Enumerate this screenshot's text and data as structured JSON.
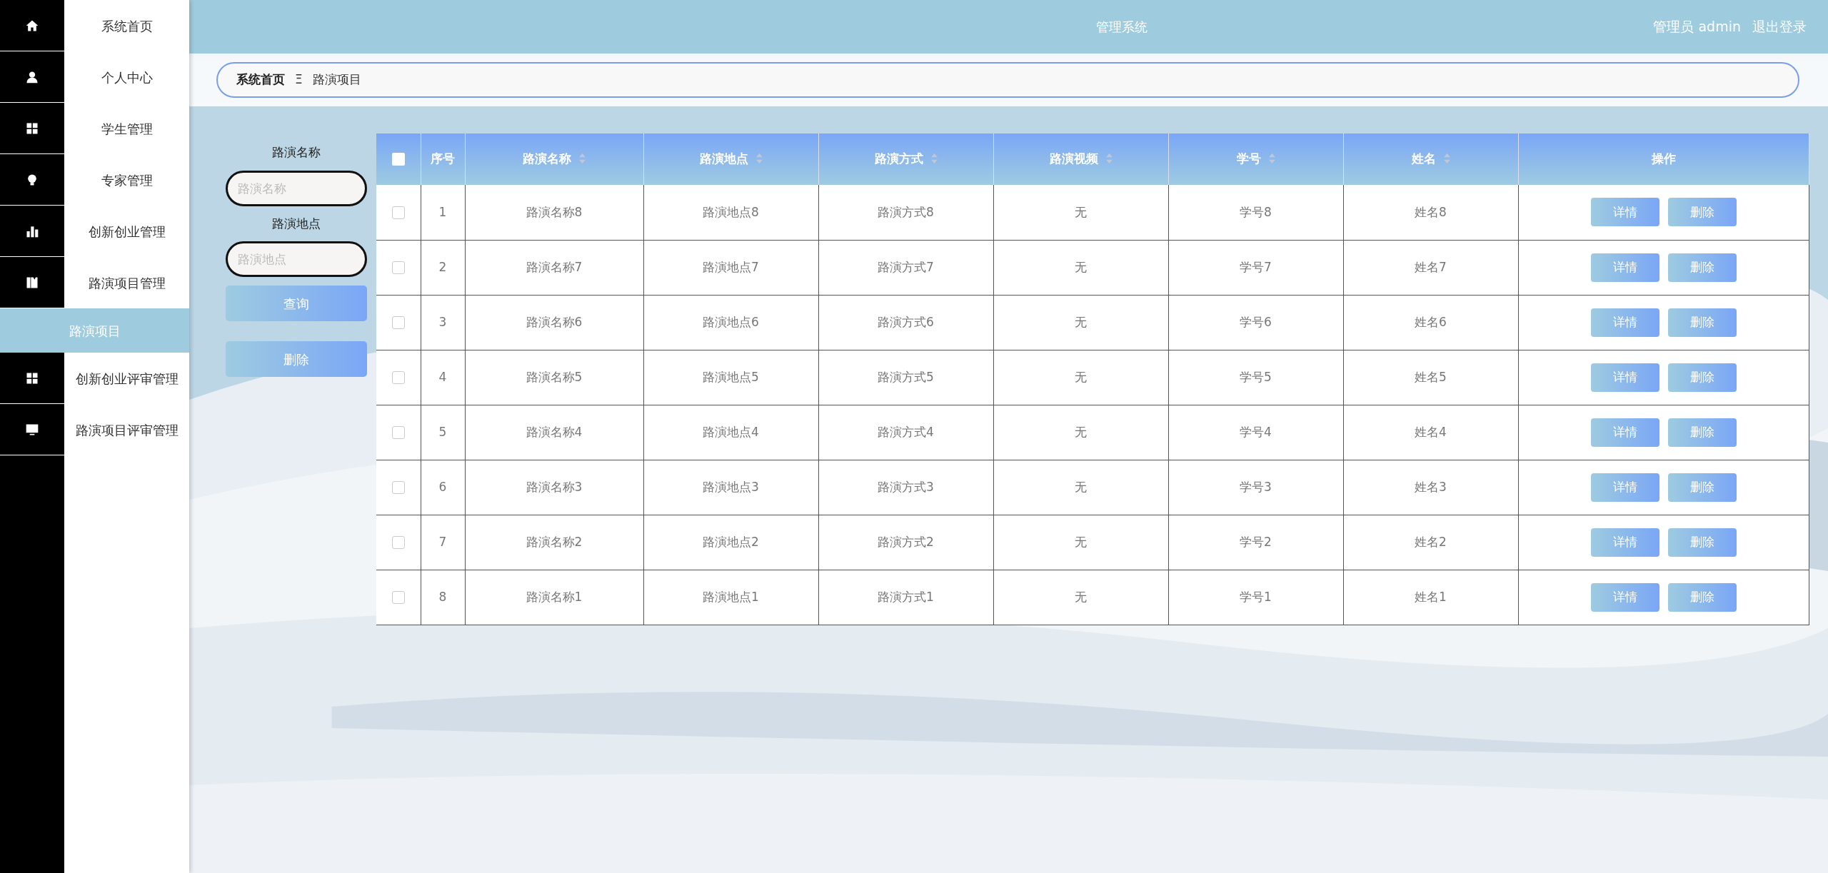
{
  "header": {
    "title": "管理系统",
    "user_role": "管理员",
    "user_name": "admin",
    "logout": "退出登录"
  },
  "sidebar": {
    "items": [
      {
        "label": "系统首页",
        "kind": "home",
        "selected": false
      },
      {
        "label": "个人中心",
        "kind": "user",
        "selected": false
      },
      {
        "label": "学生管理",
        "kind": "grid",
        "selected": false
      },
      {
        "label": "专家管理",
        "kind": "bulb",
        "selected": false
      },
      {
        "label": "创新创业管理",
        "kind": "chart",
        "selected": false
      },
      {
        "label": "路演项目管理",
        "kind": "book",
        "selected": false,
        "children": [
          {
            "label": "路演项目",
            "selected": true
          }
        ]
      },
      {
        "label": "创新创业评审管理",
        "kind": "grid",
        "selected": false
      },
      {
        "label": "路演项目评审管理",
        "kind": "monitor",
        "selected": false
      }
    ]
  },
  "breadcrumb": {
    "items": [
      "系统首页",
      "路演项目"
    ],
    "separator": "Ξ"
  },
  "search": {
    "fields": [
      {
        "label": "路演名称",
        "placeholder": "路演名称"
      },
      {
        "label": "路演地点",
        "placeholder": "路演地点"
      }
    ],
    "query_button": "查询",
    "delete_button": "删除"
  },
  "table": {
    "columns": [
      {
        "label": "序号",
        "sortable": false
      },
      {
        "label": "路演名称",
        "sortable": true
      },
      {
        "label": "路演地点",
        "sortable": true
      },
      {
        "label": "路演方式",
        "sortable": true
      },
      {
        "label": "路演视频",
        "sortable": true
      },
      {
        "label": "学号",
        "sortable": true
      },
      {
        "label": "姓名",
        "sortable": true
      },
      {
        "label": "操作",
        "sortable": false
      }
    ],
    "all_checked": false,
    "rows": [
      {
        "checked": false,
        "cells": [
          "1",
          "路演名称8",
          "路演地点8",
          "路演方式8",
          "无",
          "学号8",
          "姓名8"
        ],
        "actions": [
          "详情",
          "删除"
        ]
      },
      {
        "checked": false,
        "cells": [
          "2",
          "路演名称7",
          "路演地点7",
          "路演方式7",
          "无",
          "学号7",
          "姓名7"
        ],
        "actions": [
          "详情",
          "删除"
        ]
      },
      {
        "checked": false,
        "cells": [
          "3",
          "路演名称6",
          "路演地点6",
          "路演方式6",
          "无",
          "学号6",
          "姓名6"
        ],
        "actions": [
          "详情",
          "删除"
        ]
      },
      {
        "checked": false,
        "cells": [
          "4",
          "路演名称5",
          "路演地点5",
          "路演方式5",
          "无",
          "学号5",
          "姓名5"
        ],
        "actions": [
          "详情",
          "删除"
        ]
      },
      {
        "checked": false,
        "cells": [
          "5",
          "路演名称4",
          "路演地点4",
          "路演方式4",
          "无",
          "学号4",
          "姓名4"
        ],
        "actions": [
          "详情",
          "删除"
        ]
      },
      {
        "checked": false,
        "cells": [
          "6",
          "路演名称3",
          "路演地点3",
          "路演方式3",
          "无",
          "学号3",
          "姓名3"
        ],
        "actions": [
          "详情",
          "删除"
        ]
      },
      {
        "checked": false,
        "cells": [
          "7",
          "路演名称2",
          "路演地点2",
          "路演方式2",
          "无",
          "学号2",
          "姓名2"
        ],
        "actions": [
          "详情",
          "删除"
        ]
      },
      {
        "checked": false,
        "cells": [
          "8",
          "路演名称1",
          "路演地点1",
          "路演方式1",
          "无",
          "学号1",
          "姓名1"
        ],
        "actions": [
          "详情",
          "删除"
        ]
      }
    ]
  }
}
